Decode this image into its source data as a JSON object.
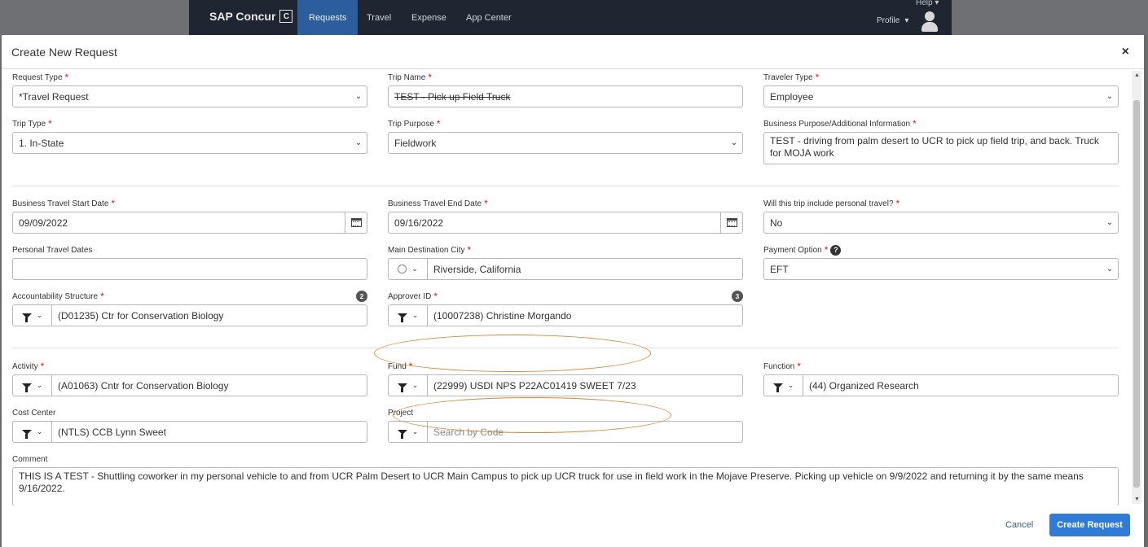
{
  "nav": {
    "brand": "SAP Concur",
    "brand_mark": "C",
    "tabs": [
      "Requests",
      "Travel",
      "Expense",
      "App Center"
    ],
    "help": "Help",
    "profile": "Profile"
  },
  "modal": {
    "title": "Create New Request",
    "close": "×"
  },
  "form": {
    "request_type": {
      "label": "Request Type",
      "value": "*Travel Request"
    },
    "trip_name": {
      "label": "Trip Name",
      "value": "TEST - Pick up Field Truck"
    },
    "traveler_type": {
      "label": "Traveler Type",
      "value": "Employee"
    },
    "trip_type": {
      "label": "Trip Type",
      "value": "1. In-State"
    },
    "trip_purpose": {
      "label": "Trip Purpose",
      "value": "Fieldwork"
    },
    "business_purpose": {
      "label": "Business Purpose/Additional Information",
      "value": "TEST - driving from palm desert to UCR to pick up field trip, and back. Truck for MOJA work"
    },
    "start_date": {
      "label": "Business Travel Start Date",
      "value": "09/09/2022"
    },
    "end_date": {
      "label": "Business Travel End Date",
      "value": "09/16/2022"
    },
    "personal_travel": {
      "label": "Will this trip include personal travel?",
      "value": "No"
    },
    "personal_dates": {
      "label": "Personal Travel Dates",
      "value": ""
    },
    "destination": {
      "label": "Main Destination City",
      "value": "Riverside, California"
    },
    "payment": {
      "label": "Payment Option",
      "value": "EFT",
      "help": "?"
    },
    "accountability": {
      "label": "Accountability Structure",
      "value": "(D01235) Ctr for Conservation Biology",
      "badge": "2"
    },
    "approver": {
      "label": "Approver ID",
      "value": "(10007238) Christine   Morgando",
      "badge": "3"
    },
    "activity": {
      "label": "Activity",
      "value": "(A01063) Cntr for Conservation Biology"
    },
    "fund": {
      "label": "Fund",
      "value": "(22999) USDI NPS P22AC01419 SWEET 7/23"
    },
    "function": {
      "label": "Function",
      "value": "(44) Organized Research"
    },
    "cost_center": {
      "label": "Cost Center",
      "value": "(NTLS) CCB Lynn Sweet"
    },
    "project": {
      "label": "Project",
      "placeholder": "Search by Code"
    },
    "comment": {
      "label": "Comment",
      "value": "THIS IS A TEST - Shuttling coworker in my personal vehicle to and from UCR Palm Desert to UCR Main Campus to pick up UCR truck for use in field work in the Mojave Preserve. Picking up vehicle on 9/9/2022 and returning it by the same means 9/16/2022."
    }
  },
  "footer": {
    "cancel": "Cancel",
    "create": "Create Request"
  },
  "colors": {
    "nav_bg": "#1f2631",
    "active_tab": "#2c5e9e",
    "primary_button": "#2f7bd6",
    "required": "#c81e1e",
    "annotation": "#d8873b"
  }
}
